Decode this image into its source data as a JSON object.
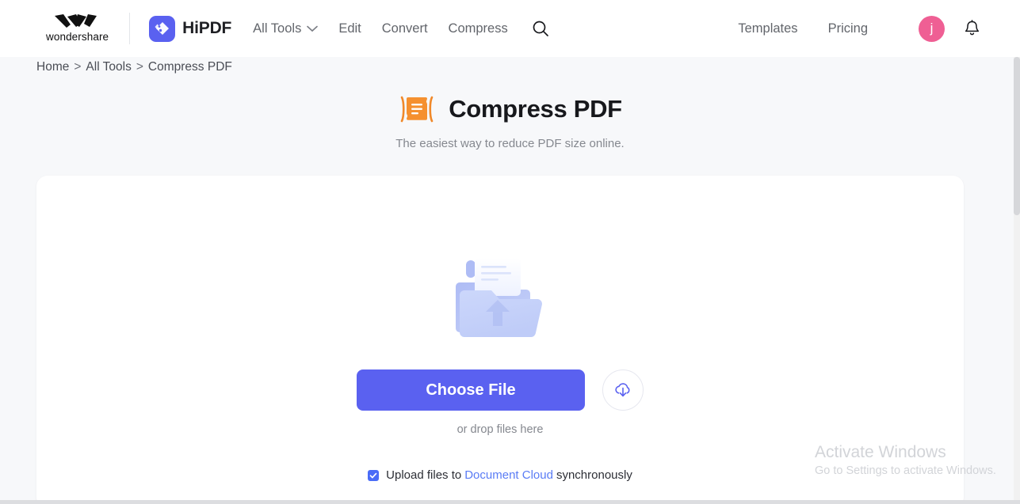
{
  "header": {
    "wondershare_wordmark": "wondershare",
    "product_name": "HiPDF",
    "nav": [
      {
        "label": "All Tools",
        "has_chevron": true
      },
      {
        "label": "Edit",
        "has_chevron": false
      },
      {
        "label": "Convert",
        "has_chevron": false
      },
      {
        "label": "Compress",
        "has_chevron": false
      }
    ],
    "search_icon": "search-icon",
    "right_nav": [
      {
        "label": "Templates"
      },
      {
        "label": "Pricing"
      }
    ],
    "avatar_initial": "j",
    "avatar_color": "#ef5f94",
    "bell_icon": "bell-icon"
  },
  "breadcrumb": {
    "items": [
      "Home",
      "All Tools",
      "Compress PDF"
    ],
    "separator": ">"
  },
  "page": {
    "title": "Compress PDF",
    "title_icon": "compress-pdf-icon",
    "subtitle": "The easiest way to reduce PDF size online."
  },
  "dropzone": {
    "illustration": "upload-folder-illustration",
    "choose_file_label": "Choose File",
    "choose_file_color": "#5a61f0",
    "cloud_button_icon": "cloud-download-icon",
    "drop_hint": "or drop files here",
    "sync_prefix": "Upload files to",
    "sync_link": "Document Cloud",
    "sync_suffix": "synchronously",
    "sync_checked": true,
    "link_color": "#5a7cf5"
  },
  "watermark": {
    "title": "Activate Windows",
    "subtitle": "Go to Settings to activate Windows."
  }
}
